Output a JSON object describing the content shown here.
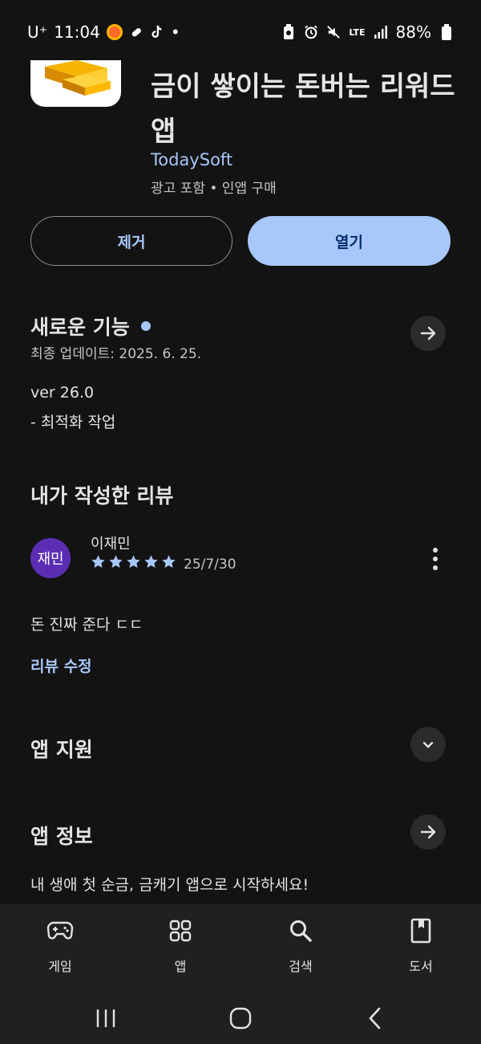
{
  "status_bar": {
    "carrier": "U⁺",
    "time": "11:04",
    "dot": "•",
    "network": "LTE",
    "battery": "88%"
  },
  "app": {
    "title": "금이 쌓이는 돈버는 리워드 앱",
    "developer": "TodaySoft",
    "meta": "광고 포함 • 인앱 구매"
  },
  "actions": {
    "remove_label": "제거",
    "open_label": "열기"
  },
  "whats_new": {
    "title": "새로운 기능",
    "last_update": "최종 업데이트: 2025. 6. 25.",
    "version": "ver 26.0",
    "note": "- 최적화 작업"
  },
  "my_review": {
    "title": "내가 작성한 리뷰",
    "avatar_text": "재민",
    "reviewer": "이재민",
    "rating": 5,
    "date": "25/7/30",
    "text": "돈 진짜 준다 ㄷㄷ",
    "edit_label": "리뷰 수정"
  },
  "app_support": {
    "title": "앱 지원"
  },
  "app_info": {
    "title": "앱 정보",
    "description": "내 생애 첫 순금, 금캐기 앱으로 시작하세요!"
  },
  "bottom_nav": {
    "items": [
      {
        "label": "게임",
        "icon": "gamepad-icon"
      },
      {
        "label": "앱",
        "icon": "apps-grid-icon"
      },
      {
        "label": "검색",
        "icon": "search-icon"
      },
      {
        "label": "도서",
        "icon": "book-icon"
      }
    ]
  },
  "colors": {
    "background": "#131313",
    "accent": "#a8c7fa",
    "avatar": "#5b2db3"
  }
}
